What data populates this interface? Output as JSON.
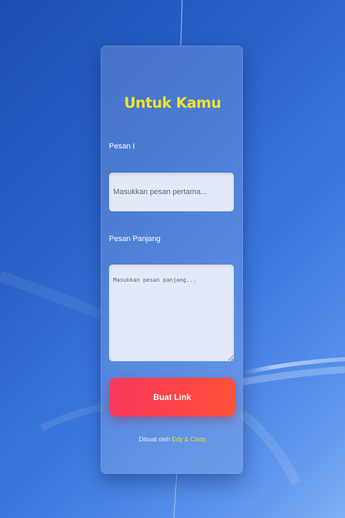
{
  "form": {
    "title": "Untuk Kamu",
    "field1_label": "Pesan I",
    "field1_placeholder": "Masukkan pesan pertama...",
    "field2_label": "Pesan Panjang",
    "field2_placeholder": "Masukkan pesan panjang...",
    "submit_label": "Buat Link"
  },
  "footer": {
    "prefix": "Dibuat oleh",
    "names": "Edy & Cindy"
  },
  "colors": {
    "accent_yellow": "#f4e32a",
    "button_start": "#f63a5e",
    "button_end": "#ff5238",
    "field_bg": "#e3e8f6"
  }
}
